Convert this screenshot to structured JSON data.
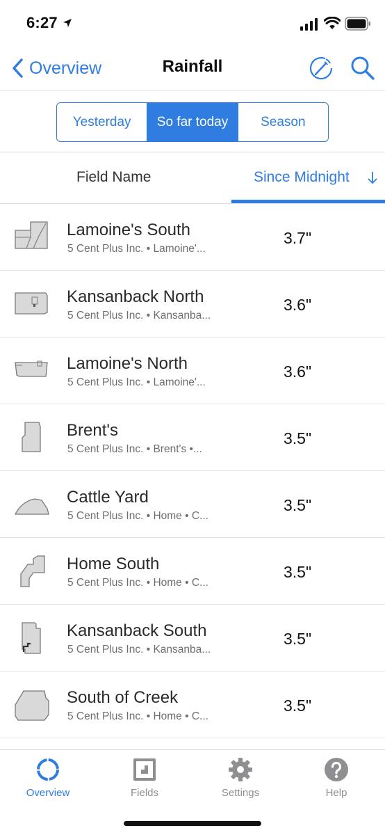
{
  "status_bar": {
    "time": "6:27"
  },
  "nav": {
    "back_label": "Overview",
    "title": "Rainfall"
  },
  "segments": [
    {
      "label": "Yesterday",
      "active": false
    },
    {
      "label": "So far today",
      "active": true
    },
    {
      "label": "Season",
      "active": false
    }
  ],
  "columns": {
    "field_name": "Field Name",
    "since_midnight": "Since Midnight"
  },
  "rows": [
    {
      "name": "Lamoine's South",
      "subtitle": "5 Cent Plus Inc. • Lamoine'...",
      "value": "3.7\""
    },
    {
      "name": "Kansanback North",
      "subtitle": "5 Cent Plus Inc. • Kansanba...",
      "value": "3.6\""
    },
    {
      "name": "Lamoine's North",
      "subtitle": "5 Cent Plus Inc. • Lamoine'...",
      "value": "3.6\""
    },
    {
      "name": "Brent's",
      "subtitle": "5 Cent Plus Inc. • Brent's •...",
      "value": "3.5\""
    },
    {
      "name": "Cattle Yard",
      "subtitle": "5 Cent Plus Inc. • Home • C...",
      "value": "3.5\""
    },
    {
      "name": "Home South",
      "subtitle": "5 Cent Plus Inc. • Home • C...",
      "value": "3.5\""
    },
    {
      "name": "Kansanback South",
      "subtitle": "5 Cent Plus Inc. • Kansanba...",
      "value": "3.5\""
    },
    {
      "name": "South of Creek",
      "subtitle": "5 Cent Plus Inc. • Home • C...",
      "value": "3.5\""
    }
  ],
  "tabs": [
    {
      "label": "Overview",
      "icon": "overview-ring-icon",
      "active": true
    },
    {
      "label": "Fields",
      "icon": "fields-icon",
      "active": false
    },
    {
      "label": "Settings",
      "icon": "gear-icon",
      "active": false
    },
    {
      "label": "Help",
      "icon": "help-icon",
      "active": false
    }
  ],
  "colors": {
    "accent": "#2f7de1",
    "field_fill": "#d9d9d9",
    "field_stroke": "#7a7a7a",
    "tab_inactive": "#8e8e93"
  }
}
